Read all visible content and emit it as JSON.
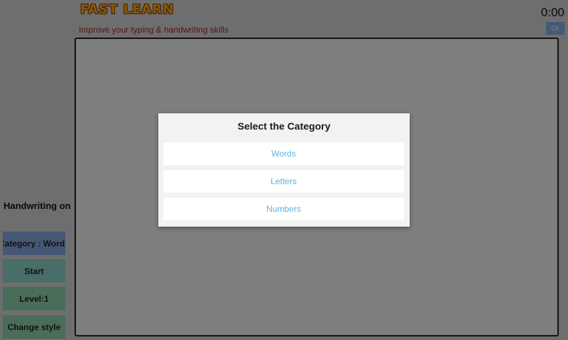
{
  "header": {
    "logo_text": "FAST LEARN",
    "subtitle": "Improve your typing & handwriting skills",
    "timer": "0:00",
    "small_button": "Clr"
  },
  "sidebar": {
    "handwriting_label": "Handwriting on",
    "category_button": "Category : Words",
    "start_button": "Start",
    "level_button": "Level:1",
    "change_style_button": "Change style"
  },
  "dialog": {
    "title": "Select the Category",
    "options": [
      "Words",
      "Letters",
      "Numbers"
    ]
  },
  "colors": {
    "option_text": "#5fb0dc",
    "subtitle_text": "#a32525",
    "category_button_bg": "#7d9ed6",
    "start_button_bg": "#86c7bd",
    "green_button_bg": "#86c7a0",
    "logo": "#f6a21a"
  }
}
